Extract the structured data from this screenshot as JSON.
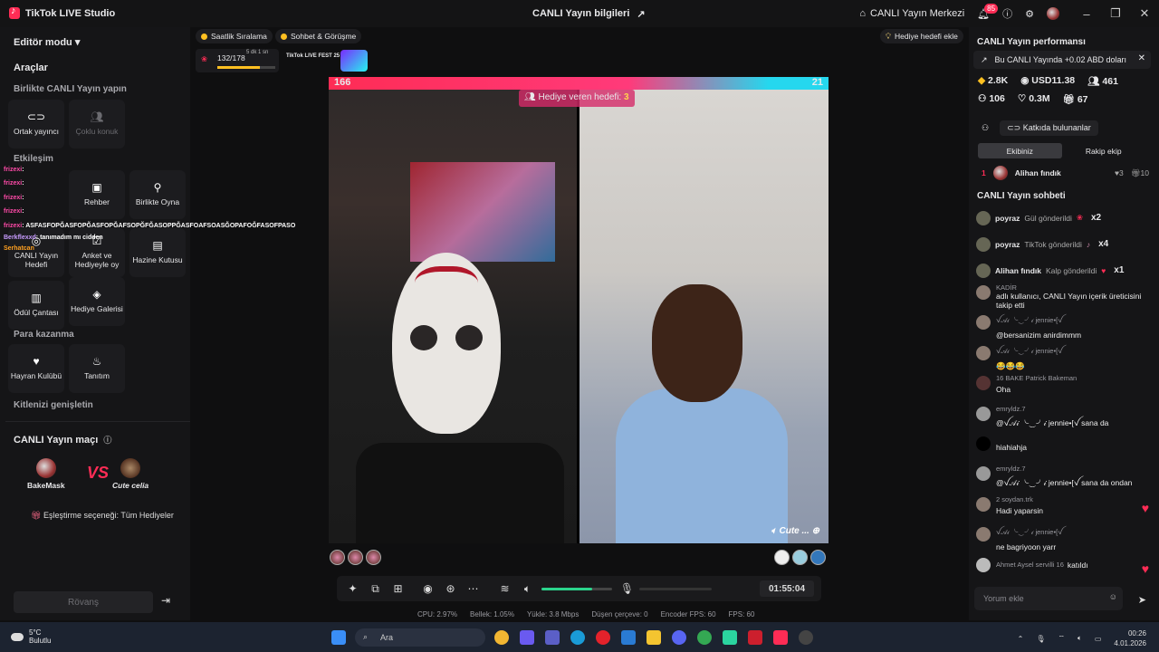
{
  "titlebar": {
    "app_name": "TikTok LIVE Studio",
    "center_title": "CANLI Yayın bilgileri",
    "live_center": "CANLI Yayın Merkezi",
    "notif_count": "85"
  },
  "left": {
    "editor_mode": "Editör modu",
    "tools_title": "Araçlar",
    "together_title": "Birlikte CANLI Yayın yapın",
    "cohost": "Ortak yayıncı",
    "multi_guest": "Çoklu konuk",
    "interaction_title": "Etkileşim",
    "guide": "Rehber",
    "play_together": "Birlikte Oyna",
    "live_goal": "CANLI Yayın Hedefi",
    "poll": "Anket ve Hediyeyle oy",
    "treasure": "Hazine Kutusu",
    "reward_bag": "Ödül Çantası",
    "gift_gallery": "Hediye Galerisi",
    "monetize_title": "Para kazanma",
    "fan_club": "Hayran Kulübü",
    "promo": "Tanıtım",
    "expand_audience": "Kitlenizi genişletin"
  },
  "match": {
    "title": "CANLI Yayın maçı",
    "player_left": "BakeMask",
    "player_right": "Cute celia",
    "vs": "VS",
    "preference": "Eşleştirme seçeneği: Tüm Hediyeler",
    "rematch": "Rövanş"
  },
  "overlay": [
    {
      "user": "frizexi",
      "text": ":"
    },
    {
      "user": "frizexi",
      "text": ":"
    },
    {
      "user": "frizexi",
      "text": ":"
    },
    {
      "user": "frizexi",
      "text": ":"
    },
    {
      "user": "frizexi",
      "text": ": ASFASFOPĞASFOPĞASFOPĞAFSOPĞFĞASOPPĞASFOAFSOASĞOPAFOĞFASOFPASO"
    },
    {
      "user": "Berkflexxd",
      "text": ": tanımadım mı cidden"
    },
    {
      "user": "Serhatcan",
      "text": ""
    }
  ],
  "top_chips": {
    "hourly_rank": "Saatlik Sıralama",
    "chat_meet": "Sohbet & Görüşme",
    "add_gift_goal": "Hediye hedefi ekle",
    "hourly_score": "132/178",
    "hourly_time": "5 dk 1 sn",
    "hourly_progress": 0.74,
    "fest_label": "TikTok LIVE FEST 25"
  },
  "stage": {
    "score_left": "166",
    "score_right": "21",
    "gift_goal_label": "Hediye veren hedefi:",
    "gift_goal_value": "3",
    "cohost_tag": "Cute ..."
  },
  "controls": {
    "timer": "01:55:04",
    "volume": 0.72
  },
  "stats": {
    "cpu": "CPU: 2.97%",
    "memory": "Bellek: 1.05%",
    "upload": "Yükle: 3.8 Mbps",
    "dropped": "Düşen çerçeve: 0",
    "encoder_fps": "Encoder FPS: 60",
    "fps": "FPS: 60"
  },
  "right": {
    "perf_title": "CANLI Yayın performansı",
    "note": "Bu CANLI Yayında +0.02 ABD doları",
    "coins": "2.8K",
    "usd": "USD11.38",
    "viewers": "461",
    "gifters": "106",
    "likes": "0.3M",
    "shares": "67",
    "contributors": "Katkıda bulunanlar",
    "tab_our_team": "Ekibiniz",
    "tab_rival": "Rakip ekip",
    "rank1_num": "1",
    "rank1_name": "Alihan fındık",
    "rank1_likes": "3",
    "rank1_gifts": "10",
    "chat_title": "CANLI Yayın sohbeti",
    "comment_placeholder": "Yorum ekle"
  },
  "gifts": [
    {
      "user": "poyraz",
      "text": "Gül gönderildi",
      "count": "x2"
    },
    {
      "user": "poyraz",
      "text": "TikTok gönderildi",
      "count": "x4"
    },
    {
      "user": "Alihan fındık",
      "text": "Kalp gönderildi",
      "count": "x1"
    }
  ],
  "chat": [
    {
      "name": "KADİR",
      "text": "adlı kullanıcı, CANLI Yayın içerik üreticisini takip etti"
    },
    {
      "name": "ꪜ𝒜𝒾 ╰‿╯𝒾 jennie•[ꪜ",
      "text": "@bersanizim anirdimmm"
    },
    {
      "name": "ꪜ𝒜𝒾 ╰‿╯𝒾 jennie•[ꪜ",
      "text": "😂😂😂"
    },
    {
      "name": "16 BAKE Patrick Bakeman",
      "text": "Oha"
    },
    {
      "name": "emryldz.7",
      "text": "@ꪜ𝒜𝒾 ╰‿╯𝒾 jennie•[ꪜ sana da"
    },
    {
      "name": "",
      "text": "hiahiahja"
    },
    {
      "name": "emryldz.7",
      "text": "@ꪜ𝒜𝒾 ╰‿╯𝒾 jennie•[ꪜ sana da ondan"
    },
    {
      "name": "2 soydan.trk",
      "text": "Hadi yaparsin"
    },
    {
      "name": "ꪜ𝒜𝒾 ╰‿╯𝒾 jennie•[ꪜ",
      "text": "ne bagriyoon yarr"
    },
    {
      "name": "Ahmet Aysel servilli 16",
      "text": "katıldı"
    }
  ],
  "taskbar": {
    "temp": "5°C",
    "weather": "Bulutlu",
    "search": "Ara",
    "time": "00:26",
    "date": "4.01.2026"
  }
}
